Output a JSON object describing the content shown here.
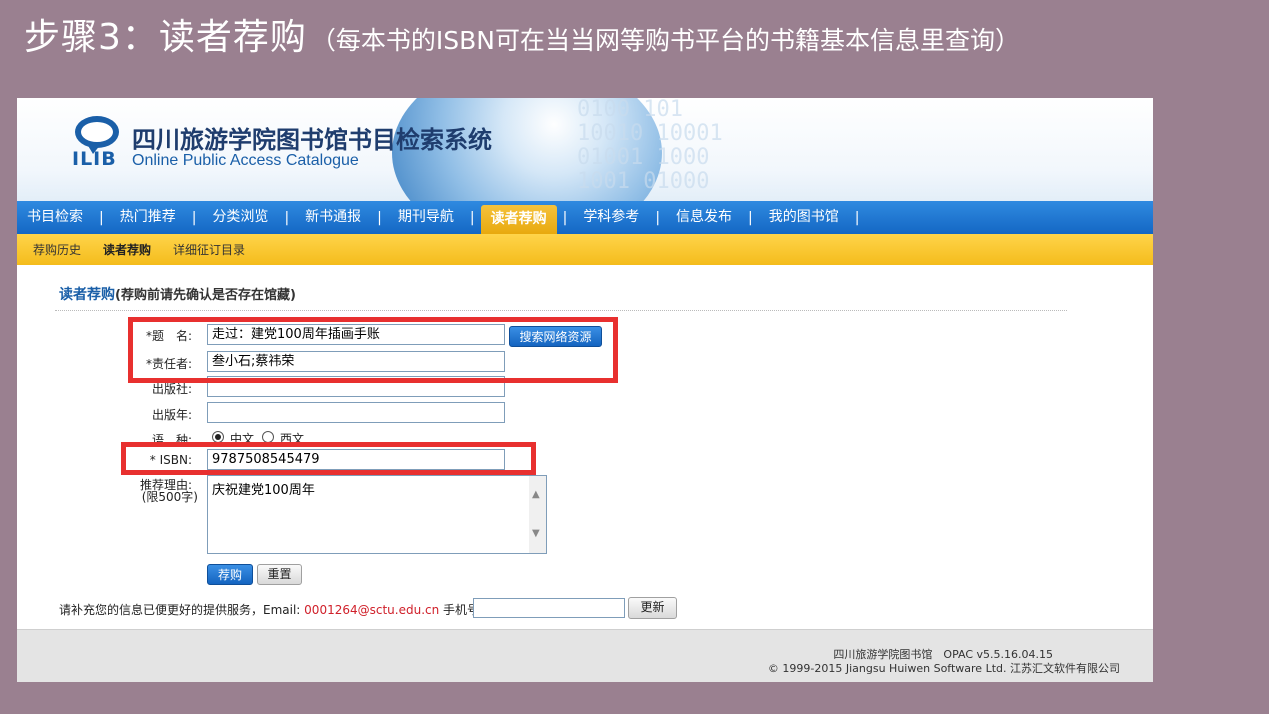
{
  "slide": {
    "title": "步骤3：读者荐购",
    "subtitle": "（每本书的ISBN可在当当网等购书平台的书籍基本信息里查询）"
  },
  "banner": {
    "logo_text": "ILIB",
    "title": "四川旅游学院图书馆书目检索系统",
    "subtitle": "Online Public Access Catalogue",
    "binary_deco": "0100 101\n10010 10001\n01001 1000\n1001 01000"
  },
  "nav": {
    "items": [
      {
        "label": "书目检索",
        "active": false
      },
      {
        "label": "热门推荐",
        "active": false
      },
      {
        "label": "分类浏览",
        "active": false
      },
      {
        "label": "新书通报",
        "active": false
      },
      {
        "label": "期刊导航",
        "active": false
      },
      {
        "label": "读者荐购",
        "active": true
      },
      {
        "label": "学科参考",
        "active": false
      },
      {
        "label": "信息发布",
        "active": false
      },
      {
        "label": "我的图书馆",
        "active": false
      }
    ],
    "separator": "|"
  },
  "subnav": {
    "items": [
      {
        "label": "荐购历史",
        "active": false
      },
      {
        "label": "读者荐购",
        "active": true
      },
      {
        "label": "详细征订目录",
        "active": false
      }
    ]
  },
  "form": {
    "section_title": "读者荐购",
    "section_note": "(荐购前请先确认是否存在馆藏)",
    "title_label": "*题　名:",
    "title_value": "走过：建党100周年插画手账",
    "search_web_button": "搜索网络资源",
    "author_label": "*责任者:",
    "author_value": "叁小石;蔡祎荣",
    "publisher_label": "出版社:",
    "publisher_value": "",
    "year_label": "出版年:",
    "year_value": "",
    "language_label": "语　种:",
    "language_options": [
      {
        "label": "中文",
        "selected": true
      },
      {
        "label": "西文",
        "selected": false
      }
    ],
    "isbn_label": "* ISBN:",
    "isbn_value": "9787508545479",
    "reason_label": "推荐理由:",
    "reason_limit": "(限500字)",
    "reason_value": "庆祝建党100周年",
    "submit_button": "荐购",
    "reset_button": "重置"
  },
  "contact": {
    "prompt": "请补充您的信息已便更好的提供服务，Email:",
    "email": "0001264@sctu.edu.cn",
    "phone_label": "手机号:",
    "phone_value": "",
    "update_button": "更新"
  },
  "footer": {
    "line1": "四川旅游学院图书馆　OPAC v5.5.16.04.15",
    "line2": "© 1999-2015 Jiangsu Huiwen Software Ltd. 江苏汇文软件有限公司"
  },
  "colors": {
    "slide_bg": "#9a8090",
    "nav_blue": "#1467c4",
    "nav_active": "#e8a90e",
    "subnav_yellow": "#f4bc1c",
    "highlight_red": "#e8302f",
    "email_red": "#d0202a"
  }
}
